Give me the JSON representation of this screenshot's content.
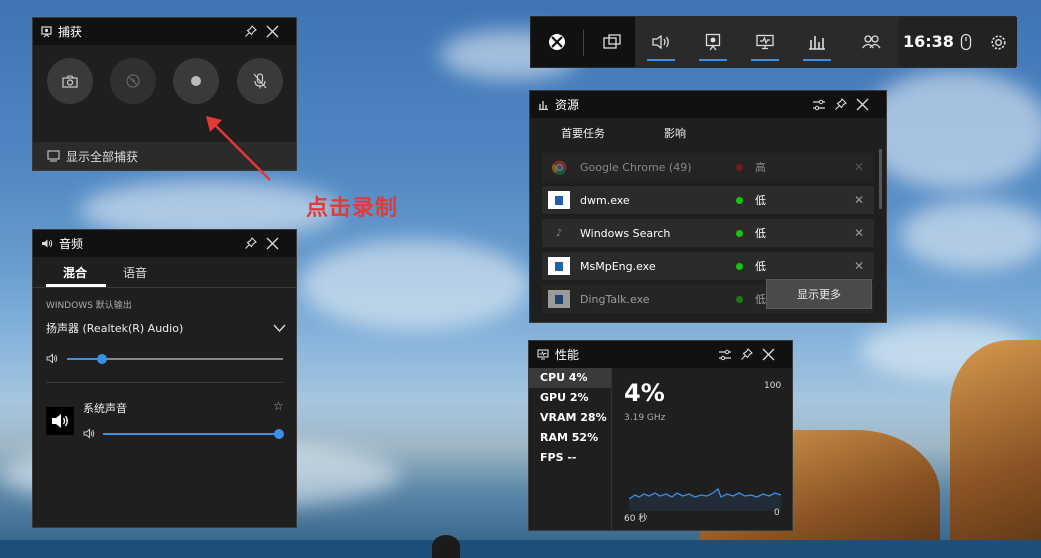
{
  "top_bar": {
    "time": "16:38"
  },
  "capture": {
    "title": "捕获",
    "show_all": "显示全部捕获"
  },
  "annotation": {
    "text": "点击录制"
  },
  "audio": {
    "title": "音频",
    "tabs": [
      "混合",
      "语音"
    ],
    "device_label": "WINDOWS 默认输出",
    "device": "扬声器 (Realtek(R) Audio)",
    "master_volume_pct": 16,
    "app_name": "系统声音",
    "app_volume_pct": 100
  },
  "resources": {
    "title": "资源",
    "cols": [
      "首要任务",
      "影响"
    ],
    "rows": [
      {
        "name": "Google Chrome (49)",
        "impact": "高",
        "color": "#e81123",
        "icon": "chrome-icon"
      },
      {
        "name": "dwm.exe",
        "impact": "低",
        "color": "#16c60c",
        "icon": "window-icon"
      },
      {
        "name": "Windows Search",
        "impact": "低",
        "color": "#16c60c",
        "icon": "search-app-icon"
      },
      {
        "name": "MsMpEng.exe",
        "impact": "低",
        "color": "#16c60c",
        "icon": "window-icon"
      },
      {
        "name": "DingTalk.exe",
        "impact": "低",
        "color": "#16c60c",
        "icon": "window-icon"
      }
    ],
    "show_more": "显示更多"
  },
  "performance": {
    "title": "性能",
    "items": [
      "CPU  4%",
      "GPU  2%",
      "VRAM  28%",
      "RAM  52%",
      "FPS  --"
    ],
    "big": "4%",
    "freq": "3.19 GHz",
    "max": "100",
    "min": "0",
    "span": "60 秒"
  }
}
